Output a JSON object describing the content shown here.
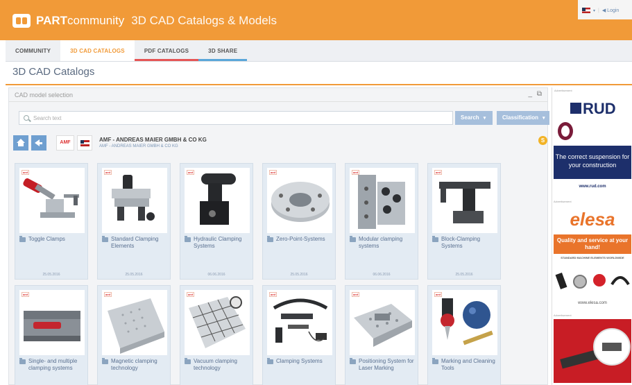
{
  "header": {
    "brand_bold": "PART",
    "brand_light": "community",
    "subtitle": "3D CAD Catalogs & Models",
    "login": "◀ Login"
  },
  "nav": {
    "tabs": [
      {
        "label": "COMMUNITY"
      },
      {
        "label": "3D CAD CATALOGS"
      },
      {
        "label": "PDF CATALOGS"
      },
      {
        "label": "3D SHARE"
      }
    ]
  },
  "page": {
    "title": "3D CAD Catalogs"
  },
  "panel": {
    "title": "CAD model selection",
    "controls": "_ ⧉",
    "search_placeholder": "Search text",
    "search_button": "Search",
    "classification_button": "Classification",
    "caret": "▾",
    "company_name": "AMF - ANDREAS MAIER GMBH & CO KG",
    "company_sub": "AMF - ANDREAS MAIER GMBH & CO KG",
    "amf_logo": "AMF",
    "badge": "S",
    "mini_logo": "amf"
  },
  "cards": [
    {
      "label": "Toggle Clamps",
      "date": "25.05.2016"
    },
    {
      "label": "Standard Clamping Elements",
      "date": "25.05.2016"
    },
    {
      "label": "Hydraulic Clamping Systems",
      "date": "06.06.2016"
    },
    {
      "label": "Zero-Point-Systems",
      "date": "25.05.2016"
    },
    {
      "label": "Modular clamping systems",
      "date": "06.06.2016"
    },
    {
      "label": "Block-Clamping Systems",
      "date": "25.05.2016"
    },
    {
      "label": "Single- and multiple clamping systems",
      "date": ""
    },
    {
      "label": "Magnetic clamping technology",
      "date": ""
    },
    {
      "label": "Vacuum clamping technology",
      "date": ""
    },
    {
      "label": "Clamping Systems",
      "date": ""
    },
    {
      "label": "Positioning System for Laser Marking",
      "date": ""
    },
    {
      "label": "Marking and Cleaning Tools",
      "date": ""
    }
  ],
  "ads": {
    "tag": "Advertisement",
    "rud_logo": "RUD",
    "rud_tagline": "The correct suspension for your construction",
    "rud_url": "www.rud.com",
    "elesa_logo": "elesa",
    "elesa_tagline": "Quality and service at your hand!",
    "elesa_strap": "STANDARD MACHINE ELEMENTS WORLDWIDE",
    "elesa_url": "www.elesa.com"
  },
  "colors": {
    "brand_orange": "#f19a38",
    "link_blue": "#6f9fd0",
    "rud_navy": "#1d2f6b",
    "elesa_orange": "#e9742b"
  }
}
